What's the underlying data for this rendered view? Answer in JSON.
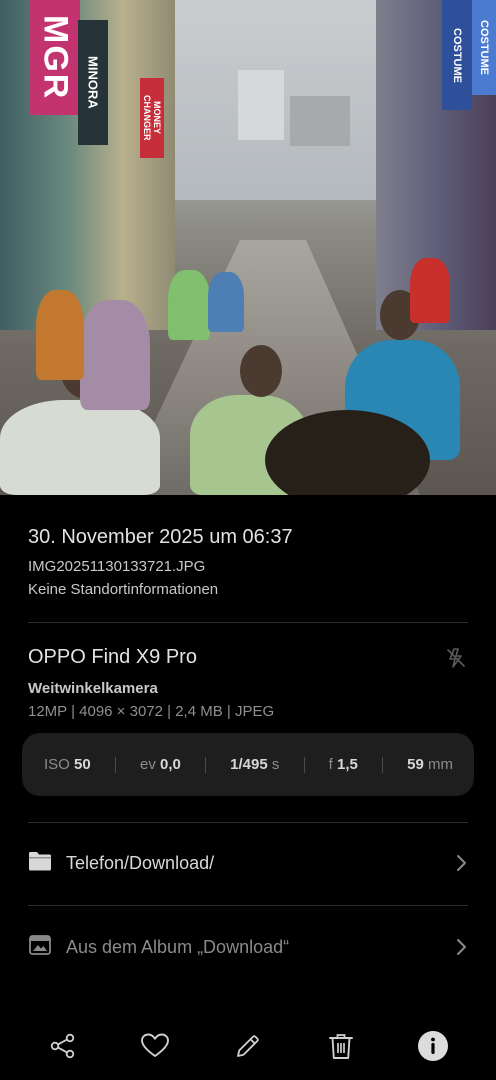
{
  "photo": {
    "signs": {
      "mgr": "MGR",
      "minora": "MINORA",
      "money_changer": "MONEY CHANGER",
      "costume": "COSTUME",
      "costume_right": "COSTUME"
    }
  },
  "details": {
    "date_time": "30. November 2025 um 06:37",
    "filename": "IMG20251130133721.JPG",
    "location": "Keine Standortinformationen"
  },
  "camera": {
    "device": "OPPO Find X9 Pro",
    "lens": "Weitwinkelkamera",
    "specs": "12MP | 4096 × 3072 | 2,4 MB | JPEG",
    "flash_icon": "flash-off-icon"
  },
  "exif": {
    "iso_label": "ISO",
    "iso_value": "50",
    "ev_label": "ev",
    "ev_value": "0,0",
    "shutter_value": "1/495",
    "shutter_unit": "s",
    "aperture_label": "f",
    "aperture_value": "1,5",
    "focal_value": "59",
    "focal_unit": "mm"
  },
  "path": {
    "label": "Telefon/Download/",
    "icon": "folder-icon"
  },
  "album": {
    "label": "Aus dem Album „Download“",
    "icon": "album-icon"
  },
  "toolbar": {
    "share_icon": "share-icon",
    "favorite_icon": "heart-icon",
    "edit_icon": "pencil-icon",
    "delete_icon": "trash-icon",
    "info_icon": "info-icon"
  },
  "colors": {
    "background": "#000000",
    "exif_card": "#1e1e1e",
    "primary_text": "#e2e2e2",
    "secondary_text": "#8f8f8f"
  }
}
